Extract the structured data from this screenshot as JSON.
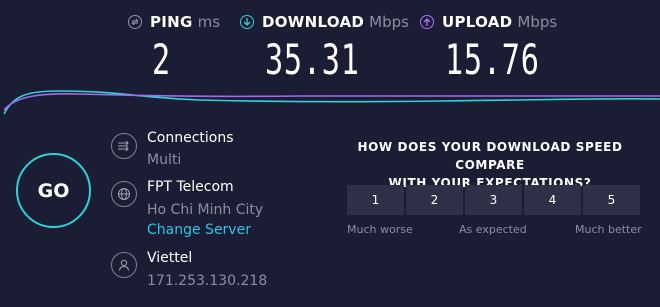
{
  "metrics": {
    "ping": {
      "name": "PING",
      "unit": "ms",
      "value": "2",
      "icon": "ping-icon"
    },
    "download": {
      "name": "DOWNLOAD",
      "unit": "Mbps",
      "value": "35.31",
      "icon": "download-arrow-icon",
      "color": "#2fd0d8"
    },
    "upload": {
      "name": "UPLOAD",
      "unit": "Mbps",
      "value": "15.76",
      "icon": "upload-arrow-icon",
      "color": "#b470ff"
    }
  },
  "go_label": "GO",
  "connections": {
    "title": "Connections",
    "value": "Multi",
    "icon": "connections-icon"
  },
  "server": {
    "name": "FPT Telecom",
    "location": "Ho Chi Minh City",
    "change_label": "Change Server",
    "icon": "globe-icon"
  },
  "provider": {
    "name": "Viettel",
    "ip": "171.253.130.218",
    "icon": "user-icon"
  },
  "survey": {
    "question_line1": "HOW DOES YOUR DOWNLOAD SPEED COMPARE",
    "question_line2": "WITH YOUR EXPECTATIONS?",
    "options": [
      "1",
      "2",
      "3",
      "4",
      "5"
    ],
    "label_low": "Much worse",
    "label_mid": "As expected",
    "label_high": "Much better"
  },
  "colors": {
    "background": "#1b1d34",
    "accent": "#2fd0d8",
    "upload": "#b470ff",
    "link": "#2fc4e8"
  }
}
